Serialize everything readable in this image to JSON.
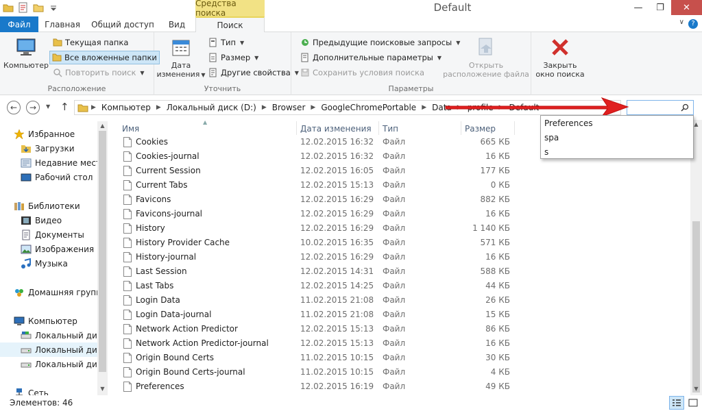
{
  "window": {
    "title": "Default",
    "context_tab": "Средства поиска",
    "minimize": "—",
    "maximize": "❐",
    "close": "✕"
  },
  "tabs": {
    "file": "Файл",
    "home": "Главная",
    "share": "Общий доступ",
    "view": "Вид",
    "search": "Поиск",
    "help": "?"
  },
  "ribbon": {
    "location": {
      "label": "Расположение",
      "computer": "Компьютер",
      "current_folder": "Текущая папка",
      "all_subfolders": "Все вложенные папки",
      "repeat_search": "Повторить поиск"
    },
    "refine": {
      "label": "Уточнить",
      "date_modified_1": "Дата",
      "date_modified_2": "изменения",
      "type": "Тип",
      "size": "Размер",
      "other_props": "Другие свойства"
    },
    "options": {
      "label": "Параметры",
      "recent_searches": "Предыдущие поисковые запросы",
      "advanced": "Дополнительные параметры",
      "save_search": "Сохранить условия поиска",
      "open_location_1": "Открыть",
      "open_location_2": "расположение файла"
    },
    "close_search_1": "Закрыть",
    "close_search_2": "окно поиска"
  },
  "address": {
    "crumbs": [
      "Компьютер",
      "Локальный диск (D:)",
      "Browser",
      "GoogleChromePortable",
      "Data",
      "profile",
      "Default"
    ],
    "search_value": ""
  },
  "nav": {
    "favorites": "Избранное",
    "downloads": "Загрузки",
    "recent": "Недавние места",
    "desktop": "Рабочий стол",
    "libraries": "Библиотеки",
    "video": "Видео",
    "documents": "Документы",
    "images": "Изображения",
    "music": "Музыка",
    "homegroup": "Домашняя группа",
    "computer": "Компьютер",
    "disk1": "Локальный диск",
    "disk2": "Локальный диск",
    "disk3": "Локальный диск",
    "network": "Сеть"
  },
  "columns": {
    "name": "Имя",
    "date": "Дата изменения",
    "type": "Тип",
    "size": "Размер"
  },
  "files": [
    {
      "name": "Cookies",
      "date": "12.02.2015 16:32",
      "type": "Файл",
      "size": "665 КБ"
    },
    {
      "name": "Cookies-journal",
      "date": "12.02.2015 16:32",
      "type": "Файл",
      "size": "16 КБ"
    },
    {
      "name": "Current Session",
      "date": "12.02.2015 16:05",
      "type": "Файл",
      "size": "177 КБ"
    },
    {
      "name": "Current Tabs",
      "date": "12.02.2015 15:13",
      "type": "Файл",
      "size": "0 КБ"
    },
    {
      "name": "Favicons",
      "date": "12.02.2015 16:29",
      "type": "Файл",
      "size": "882 КБ"
    },
    {
      "name": "Favicons-journal",
      "date": "12.02.2015 16:29",
      "type": "Файл",
      "size": "16 КБ"
    },
    {
      "name": "History",
      "date": "12.02.2015 16:29",
      "type": "Файл",
      "size": "1 140 КБ"
    },
    {
      "name": "History Provider Cache",
      "date": "10.02.2015 16:35",
      "type": "Файл",
      "size": "571 КБ"
    },
    {
      "name": "History-journal",
      "date": "12.02.2015 16:29",
      "type": "Файл",
      "size": "16 КБ"
    },
    {
      "name": "Last Session",
      "date": "12.02.2015 14:31",
      "type": "Файл",
      "size": "588 КБ"
    },
    {
      "name": "Last Tabs",
      "date": "12.02.2015 14:25",
      "type": "Файл",
      "size": "44 КБ"
    },
    {
      "name": "Login Data",
      "date": "11.02.2015 21:08",
      "type": "Файл",
      "size": "26 КБ"
    },
    {
      "name": "Login Data-journal",
      "date": "11.02.2015 21:08",
      "type": "Файл",
      "size": "15 КБ"
    },
    {
      "name": "Network Action Predictor",
      "date": "12.02.2015 15:13",
      "type": "Файл",
      "size": "86 КБ"
    },
    {
      "name": "Network Action Predictor-journal",
      "date": "12.02.2015 15:13",
      "type": "Файл",
      "size": "16 КБ"
    },
    {
      "name": "Origin Bound Certs",
      "date": "11.02.2015 10:15",
      "type": "Файл",
      "size": "30 КБ"
    },
    {
      "name": "Origin Bound Certs-journal",
      "date": "11.02.2015 10:15",
      "type": "Файл",
      "size": "4 КБ"
    },
    {
      "name": "Preferences",
      "date": "12.02.2015 16:19",
      "type": "Файл",
      "size": "49 КБ"
    }
  ],
  "suggestions": [
    "Preferences",
    "spa",
    "s"
  ],
  "status": {
    "count": "Элементов: 46"
  },
  "colors": {
    "file_tab": "#1979ca",
    "context_tab": "#f2e285",
    "close_button": "#c7504c",
    "arrow": "#e02020"
  }
}
